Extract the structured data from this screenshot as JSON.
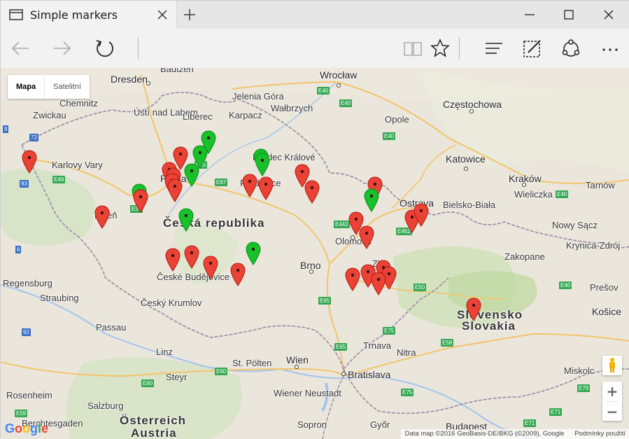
{
  "browser": {
    "tab_title": "Simple markers",
    "icons": {
      "tab": "page-icon",
      "close": "close-icon",
      "new_tab": "plus-icon",
      "minimize": "minimize-icon",
      "maximize": "maximize-icon",
      "close_window": "close-window-icon",
      "back": "back-arrow-icon",
      "forward": "forward-arrow-icon",
      "refresh": "refresh-icon",
      "reading_view": "reading-view-icon",
      "favorite": "star-icon",
      "hub": "hub-icon",
      "web_note": "web-note-icon",
      "share": "share-icon",
      "more": "more-icon"
    }
  },
  "map": {
    "maptype": {
      "map": "Mapa",
      "satellite": "Satelitní"
    },
    "cities": [
      "Bautzen",
      "Wrocław",
      "Dresden",
      "Jelenia Góra",
      "Chemnitz",
      "Ústí nad Labem",
      "Liberec",
      "Wałbrzych",
      "Częstochowa",
      "Zwickau",
      "Karpacz",
      "Opole",
      "Hradec Králové",
      "Katowice",
      "Karlovy Vary",
      "Praha",
      "Pardubice",
      "Kraków",
      "Tarnów",
      "Ostrava",
      "Bielsko-Biała",
      "Wieliczka",
      "Plzeň",
      "Olomouc",
      "Nowy Sącz",
      "Krynica-Zdrój",
      "Zakopane",
      "Brno",
      "Regensburg",
      "České Budějovice",
      "Zlín",
      "Straubing",
      "Český Krumlov",
      "Prešov",
      "Košice",
      "Passau",
      "Trnava",
      "Nitra",
      "Linz",
      "Wien",
      "St. Pölten",
      "Bratislava",
      "Steyr",
      "Miskolc",
      "Wiener Neustadt",
      "Rosenheim",
      "Salzburg",
      "Sopron",
      "Győr",
      "Budapest",
      "Berchtesgaden"
    ],
    "countries": {
      "czech": "Česká republika",
      "slovakia_1": "Slovensko",
      "slovakia_2": "Slovakia",
      "austria_1": "Österreich",
      "austria_2": "Austria"
    },
    "roads": [
      "E40",
      "E40",
      "E40",
      "E65",
      "E67",
      "E40",
      "E49",
      "E50",
      "E442",
      "E462",
      "E40",
      "72",
      "9",
      "93",
      "6",
      "92",
      "E50",
      "E65",
      "E75",
      "E65",
      "E58",
      "E75",
      "E60",
      "E60",
      "E71",
      "E79",
      "E71",
      "E59"
    ],
    "markers": {
      "colors": {
        "red": "#ea4335",
        "green": "#17c12a"
      }
    },
    "controls": {
      "zoom_in": "+",
      "zoom_out": "−",
      "pegman": "pegman-icon"
    },
    "logo": "Google",
    "attribution": "Data map ©2016 GeoBasis-DE/BKG (©2009), Google",
    "terms": "Podmínky použití"
  }
}
